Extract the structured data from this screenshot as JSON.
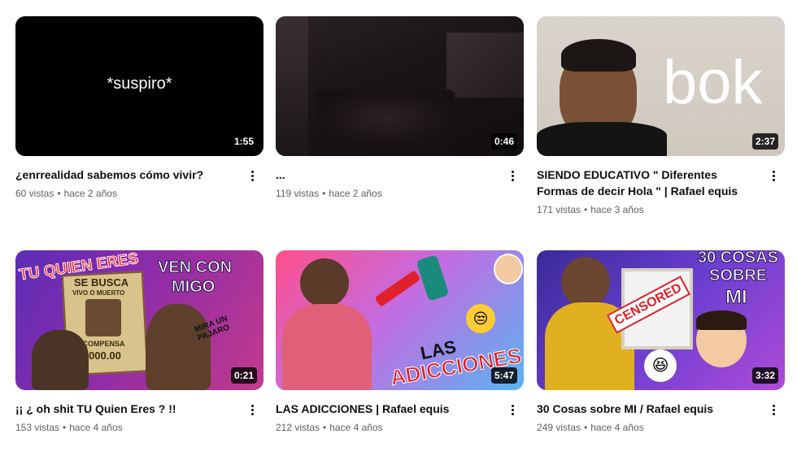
{
  "videos": [
    {
      "title": "¿enrrealidad sabemos cómo vivir?",
      "views": "60 vistas",
      "age": "hace 2 años",
      "duration": "1:55",
      "thumb_text": "*suspiro*"
    },
    {
      "title": "...",
      "views": "119 vistas",
      "age": "hace 2 años",
      "duration": "0:46"
    },
    {
      "title": "SIENDO EDUCATIVO \" Diferentes Formas de decir Hola \" | Rafael equis",
      "views": "171 vistas",
      "age": "hace 3 años",
      "duration": "2:37",
      "thumb_text": "bok"
    },
    {
      "title": "¡¡ ¿ oh shit TU Quien Eres ? !!",
      "views": "153 vistas",
      "age": "hace 4 años",
      "duration": "0:21",
      "thumb_texts": [
        "TU QUIEN ERES",
        "SE BUSCA",
        "VIVO O MUERTO",
        "RECOMPENSA",
        "$5,000.00",
        "VEN CON",
        "MIGO",
        "MIRA UN PAJARO"
      ]
    },
    {
      "title": "LAS ADICCIONES | Rafael equis",
      "views": "212 vistas",
      "age": "hace 4 años",
      "duration": "5:47",
      "thumb_texts": [
        "LAS",
        "ADICCIONES"
      ]
    },
    {
      "title": "30 Cosas sobre MI / Rafael equis",
      "views": "249 vistas",
      "age": "hace 4 años",
      "duration": "3:32",
      "thumb_texts": [
        "30 COSAS",
        "SOBRE",
        "MI",
        "CENSORED"
      ]
    }
  ],
  "separator": "•"
}
